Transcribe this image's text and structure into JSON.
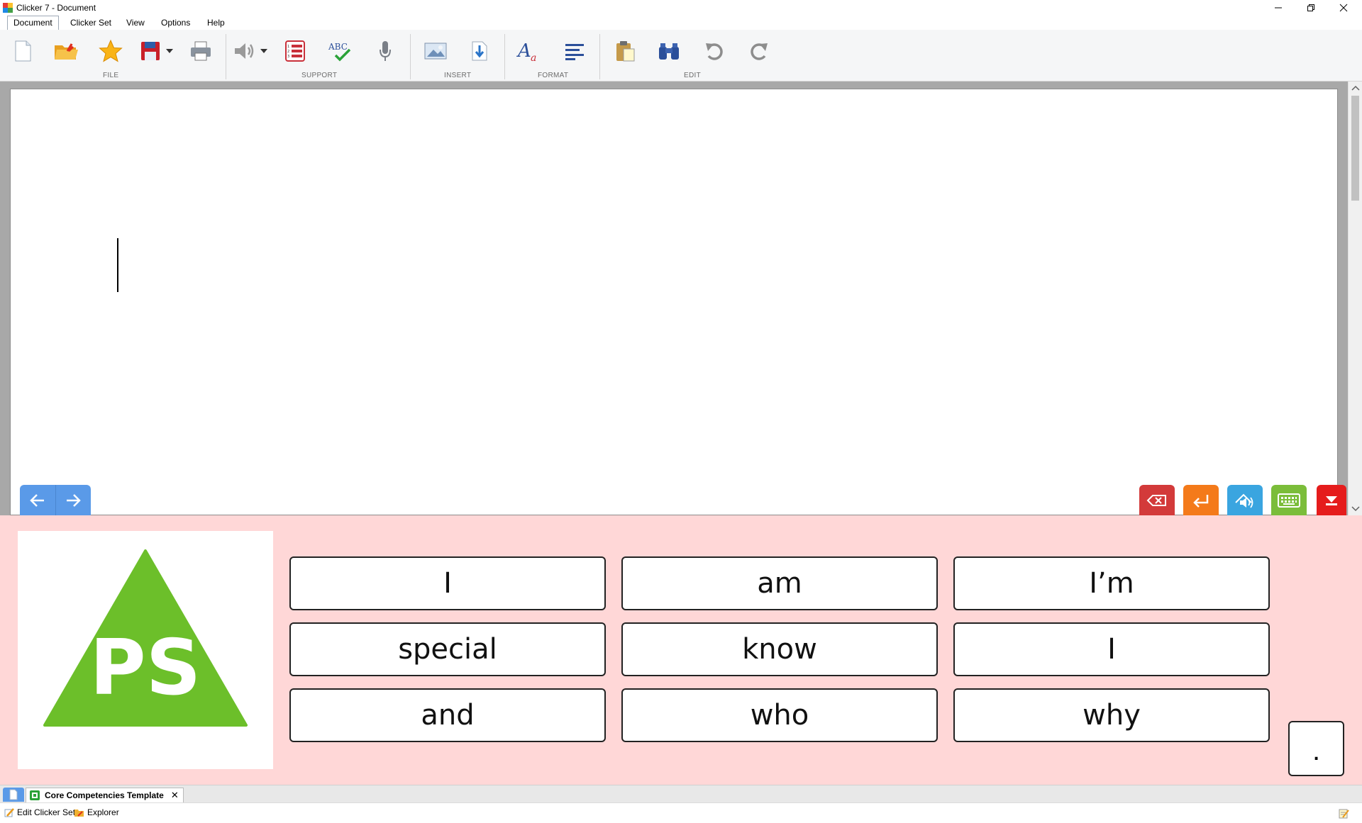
{
  "window": {
    "title": "Clicker 7 - Document"
  },
  "menu": {
    "items": [
      "Document",
      "Clicker Set",
      "View",
      "Options",
      "Help"
    ]
  },
  "ribbon": {
    "groups": [
      "FILE",
      "SUPPORT",
      "INSERT",
      "FORMAT",
      "EDIT"
    ],
    "icons": [
      "new-document-icon",
      "open-folder-icon",
      "favourite-star-icon",
      "save-disk-icon",
      "print-icon",
      "speaker-icon",
      "numbered-list-icon",
      "spell-check-icon",
      "microphone-icon",
      "insert-picture-icon",
      "insert-file-icon",
      "text-style-icon",
      "align-left-icon",
      "paste-icon",
      "find-binoculars-icon",
      "undo-icon",
      "redo-icon"
    ]
  },
  "grid": {
    "words": [
      "I",
      "am",
      "I’m",
      "special",
      "know",
      "I",
      "and",
      "who",
      "why"
    ],
    "punctuation": ".",
    "logo_text": "PS",
    "colors": {
      "panel": "#ffd7d7",
      "logo_green": "#6cbf2a"
    }
  },
  "controls": {
    "colors": {
      "delete": "#d33a3a",
      "enter": "#f47a1a",
      "speak": "#3aa5e0",
      "keyboard": "#7bbd3a",
      "collapse": "#e51c1c"
    }
  },
  "set_tab": {
    "name": "Core Competencies Template"
  },
  "status": {
    "edit_clicker_set": "Edit Clicker Set",
    "explorer": "Explorer"
  }
}
